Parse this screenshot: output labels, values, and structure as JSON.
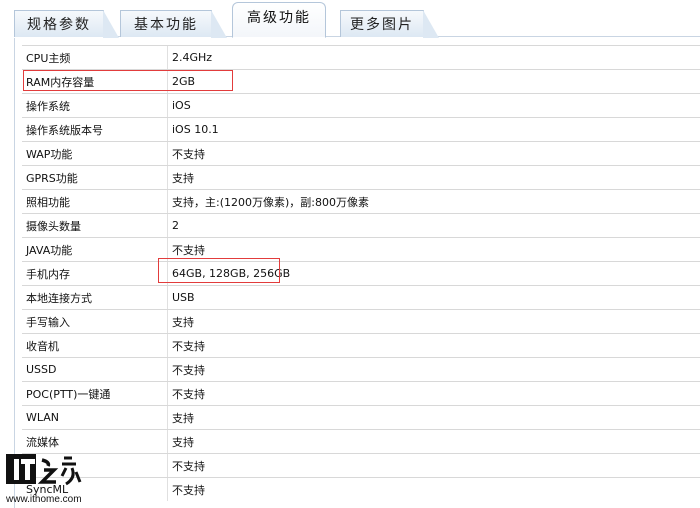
{
  "tabs": [
    {
      "label": "规格参数"
    },
    {
      "label": "基本功能"
    },
    {
      "label": "高级功能"
    },
    {
      "label": "更多图片"
    }
  ],
  "active_tab": "高级功能",
  "rows": [
    {
      "key": "CPU主频",
      "value": "2.4GHz"
    },
    {
      "key": "RAM内存容量",
      "value": "2GB"
    },
    {
      "key": "操作系统",
      "value": "iOS"
    },
    {
      "key": "操作系统版本号",
      "value": "iOS 10.1"
    },
    {
      "key": "WAP功能",
      "value": "不支持"
    },
    {
      "key": "GPRS功能",
      "value": "支持"
    },
    {
      "key": "照相功能",
      "value": "支持，主:(1200万像素)，副:800万像素"
    },
    {
      "key": "摄像头数量",
      "value": "2"
    },
    {
      "key": "JAVA功能",
      "value": "不支持"
    },
    {
      "key": "手机内存",
      "value": "64GB, 128GB, 256GB"
    },
    {
      "key": "本地连接方式",
      "value": "USB"
    },
    {
      "key": "手写输入",
      "value": "支持"
    },
    {
      "key": "收音机",
      "value": "不支持"
    },
    {
      "key": "USSD",
      "value": "不支持"
    },
    {
      "key": "POC(PTT)一键通",
      "value": "不支持"
    },
    {
      "key": "WLAN",
      "value": "支持"
    },
    {
      "key": "流媒体",
      "value": "支持"
    },
    {
      "key": "",
      "value": "不支持"
    },
    {
      "key": "SyncML",
      "value": "不支持"
    }
  ],
  "watermark": {
    "logo_text": "IT之家",
    "url": "www.ithome.com"
  },
  "colors": {
    "highlight": "#e23c3c",
    "tab_border": "#b4c6da"
  }
}
